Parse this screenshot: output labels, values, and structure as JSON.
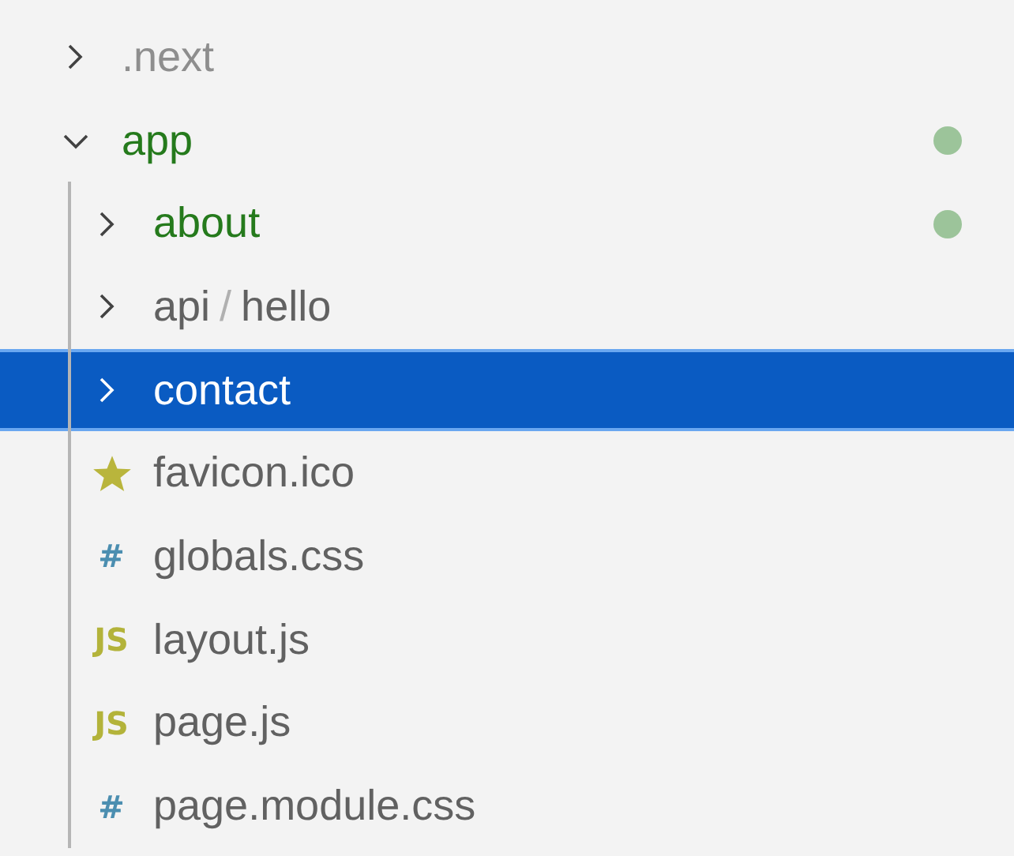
{
  "explorer": {
    "compact_separator": "/",
    "tree": [
      {
        "kind": "folder",
        "name": ".next",
        "expanded": false,
        "selected": false,
        "ignored": true,
        "modified": false
      },
      {
        "kind": "folder",
        "name": "app",
        "expanded": true,
        "selected": false,
        "ignored": false,
        "modified": true,
        "children": [
          {
            "kind": "folder",
            "name": "about",
            "expanded": false,
            "selected": false,
            "ignored": false,
            "modified": true
          },
          {
            "kind": "folder",
            "segments": [
              "api",
              "hello"
            ],
            "expanded": false,
            "selected": false,
            "ignored": false,
            "modified": false
          },
          {
            "kind": "folder",
            "name": "contact",
            "expanded": false,
            "selected": true,
            "ignored": false,
            "modified": false
          },
          {
            "kind": "file",
            "name": "favicon.ico",
            "selected": false,
            "ignored": false,
            "modified": false,
            "icon": {
              "kind": "star",
              "color": "#b9b53c"
            }
          },
          {
            "kind": "file",
            "name": "globals.css",
            "selected": false,
            "ignored": false,
            "modified": false,
            "icon": {
              "kind": "glyph",
              "text": "#",
              "color": "#4b8eb0"
            }
          },
          {
            "kind": "file",
            "name": "layout.js",
            "selected": false,
            "ignored": false,
            "modified": false,
            "icon": {
              "kind": "glyph",
              "text": "JS",
              "color": "#b3b33a"
            }
          },
          {
            "kind": "file",
            "name": "page.js",
            "selected": false,
            "ignored": false,
            "modified": false,
            "icon": {
              "kind": "glyph",
              "text": "JS",
              "color": "#b3b33a"
            }
          },
          {
            "kind": "file",
            "name": "page.module.css",
            "selected": false,
            "ignored": false,
            "modified": false,
            "icon": {
              "kind": "glyph",
              "text": "#",
              "color": "#4b8eb0"
            }
          }
        ]
      }
    ]
  }
}
